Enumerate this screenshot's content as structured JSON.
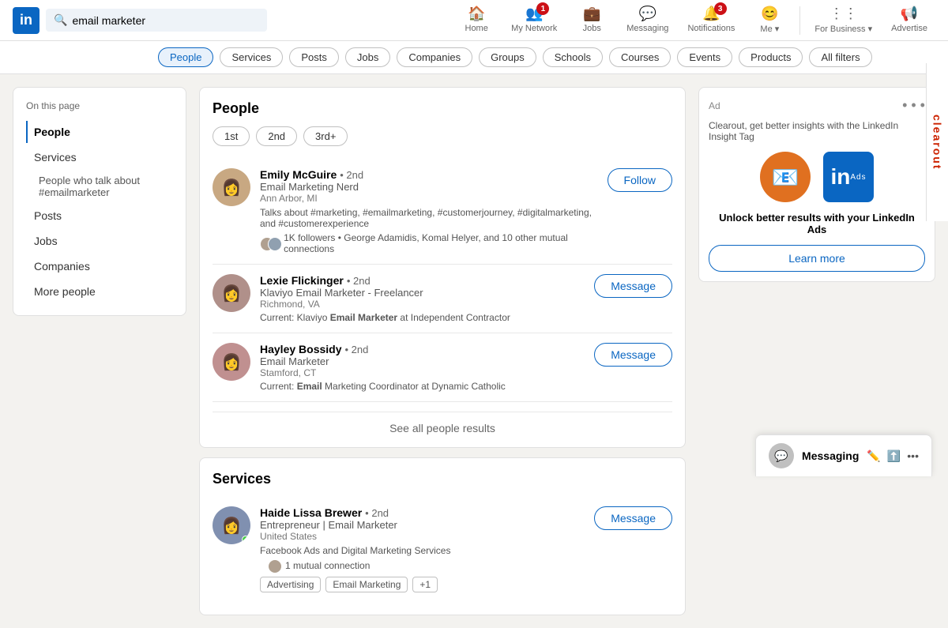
{
  "nav": {
    "logo": "in",
    "search_placeholder": "email marketer",
    "search_value": "email marketer",
    "items": [
      {
        "id": "home",
        "label": "Home",
        "icon": "🏠",
        "badge": null
      },
      {
        "id": "my-network",
        "label": "My Network",
        "icon": "👥",
        "badge": "1"
      },
      {
        "id": "jobs",
        "label": "Jobs",
        "icon": "💼",
        "badge": null
      },
      {
        "id": "messaging",
        "label": "Messaging",
        "icon": "💬",
        "badge": null
      },
      {
        "id": "notifications",
        "label": "Notifications",
        "icon": "🔔",
        "badge": "3"
      },
      {
        "id": "me",
        "label": "Me",
        "icon": "😊",
        "badge": null,
        "dropdown": true
      },
      {
        "id": "for-business",
        "label": "For Business",
        "icon": "⋮⋮⋮",
        "badge": null,
        "dropdown": true
      },
      {
        "id": "advertise",
        "label": "Advertise",
        "icon": "📢",
        "badge": null
      }
    ]
  },
  "filters": {
    "pills": [
      {
        "id": "people",
        "label": "People",
        "active": true
      },
      {
        "id": "services",
        "label": "Services",
        "active": false
      },
      {
        "id": "posts",
        "label": "Posts",
        "active": false
      },
      {
        "id": "jobs",
        "label": "Jobs",
        "active": false
      },
      {
        "id": "companies",
        "label": "Companies",
        "active": false
      },
      {
        "id": "groups",
        "label": "Groups",
        "active": false
      },
      {
        "id": "schools",
        "label": "Schools",
        "active": false
      },
      {
        "id": "courses",
        "label": "Courses",
        "active": false
      },
      {
        "id": "events",
        "label": "Events",
        "active": false
      },
      {
        "id": "products",
        "label": "Products",
        "active": false
      },
      {
        "id": "all-filters",
        "label": "All filters",
        "active": false
      }
    ]
  },
  "sidebar": {
    "on_this_page": "On this page",
    "items": [
      {
        "id": "people",
        "label": "People",
        "active": true
      },
      {
        "id": "services",
        "label": "Services",
        "active": false
      },
      {
        "id": "people-talk",
        "label": "People who talk about #emailmarketer",
        "active": false,
        "sub": true
      },
      {
        "id": "posts",
        "label": "Posts",
        "active": false
      },
      {
        "id": "jobs",
        "label": "Jobs",
        "active": false
      },
      {
        "id": "companies",
        "label": "Companies",
        "active": false
      },
      {
        "id": "more",
        "label": "More people",
        "active": false
      }
    ]
  },
  "people_section": {
    "title": "People",
    "filter_tabs": [
      "1st",
      "2nd",
      "3rd+"
    ],
    "people": [
      {
        "id": "emily",
        "name": "Emily McGuire",
        "degree": "• 2nd",
        "title": "Email Marketing Nerd",
        "location": "Ann Arbor, MI",
        "about": "Talks about #marketing, #emailmarketing, #customerjourney, #digitalmarketing, and #customerexperience",
        "mutual": "1K followers • George Adamidis, Komal Helyer, and 10 other mutual connections",
        "action": "Follow",
        "avatar_color": "#c8a882",
        "avatar_letter": "E"
      },
      {
        "id": "lexie",
        "name": "Lexie Flickinger",
        "degree": "• 2nd",
        "title": "Klaviyo Email Marketer - Freelancer",
        "location": "Richmond, VA",
        "current": "Current: Klaviyo Email Marketer at Independent Contractor",
        "current_highlight": "Email Marketer",
        "action": "Message",
        "avatar_color": "#b0908a",
        "avatar_letter": "L"
      },
      {
        "id": "hayley",
        "name": "Hayley Bossidy",
        "degree": "• 2nd",
        "title": "Email Marketer",
        "location": "Stamford, CT",
        "current": "Current: Email Marketing Coordinator at Dynamic Catholic",
        "current_highlight": "Email",
        "action": "Message",
        "avatar_color": "#c09090",
        "avatar_letter": "H"
      }
    ],
    "see_all": "See all people results"
  },
  "services_section": {
    "title": "Services",
    "people": [
      {
        "id": "haide",
        "name": "Haide Lissa Brewer",
        "degree": "• 2nd",
        "title": "Entrepreneur | Email Marketer",
        "location": "United States",
        "about": "Facebook Ads and Digital Marketing Services",
        "mutual": "1 mutual connection",
        "tags": [
          "Advertising",
          "Email Marketing",
          "+1"
        ],
        "action": "Message",
        "avatar_color": "#8090b0",
        "avatar_letter": "H",
        "online": true
      }
    ]
  },
  "ad": {
    "label": "Ad",
    "description": "Clearout, get better insights with the LinkedIn Insight Tag",
    "logo_emoji": "📧",
    "logo_text": "in",
    "headline": "Unlock better results with your LinkedIn Ads",
    "cta": "Learn more",
    "brand": "clearout"
  },
  "messaging": {
    "label": "Messaging",
    "avatar_letter": "M"
  }
}
